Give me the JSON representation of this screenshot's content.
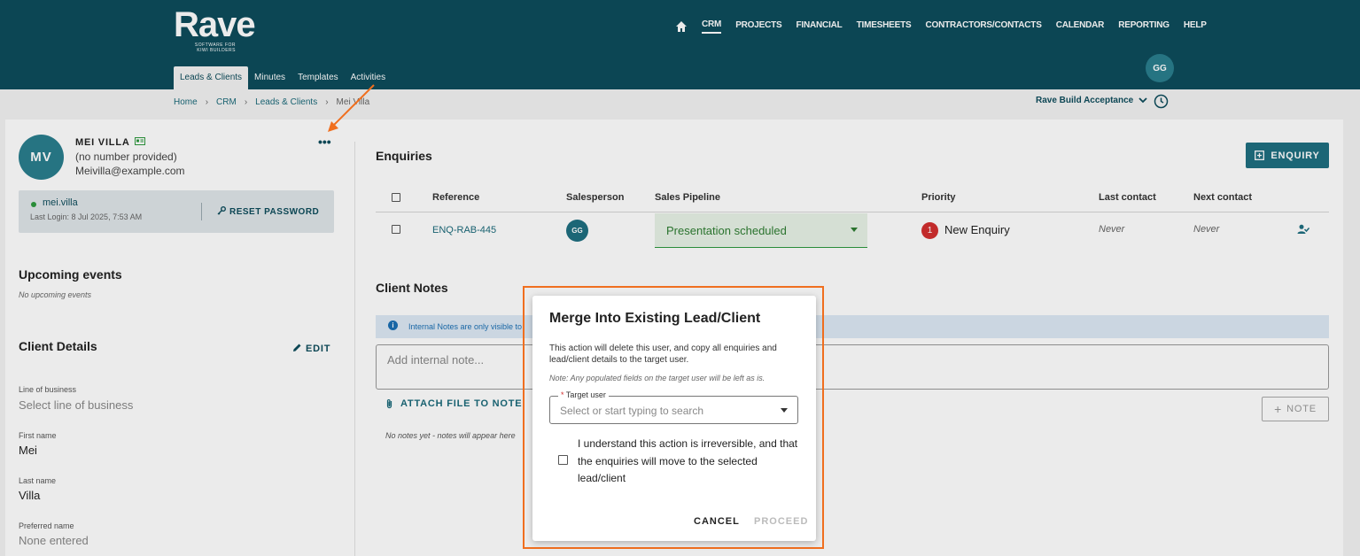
{
  "brand": {
    "logo_text": "Rave",
    "logo_sub_1": "SOFTWARE FOR",
    "logo_sub_2": "KIWI BUILDERS"
  },
  "top_nav": {
    "home_icon": "home-icon",
    "items": [
      "CRM",
      "PROJECTS",
      "FINANCIAL",
      "TIMESHEETS",
      "CONTRACTORS/CONTACTS",
      "CALENDAR",
      "REPORTING",
      "HELP"
    ],
    "active": "CRM"
  },
  "user_avatar": "GG",
  "sub_tabs": [
    "Leads & Clients",
    "Minutes",
    "Templates",
    "Activities"
  ],
  "breadcrumb": [
    "Home",
    "CRM",
    "Leads & Clients",
    "Mei Villa"
  ],
  "breadcrumb_sep": "›",
  "org_selector": "Rave Build Acceptance",
  "client": {
    "initials": "MV",
    "name": "MEI VILLA",
    "phone": "(no number provided)",
    "email": "Meivilla@example.com",
    "username": "mei.villa",
    "last_login": "Last Login: 8 Jul 2025, 7:53 AM",
    "reset_password": "RESET PASSWORD",
    "more_glyph": "•••"
  },
  "upcoming": {
    "title": "Upcoming events",
    "empty": "No upcoming events"
  },
  "client_details": {
    "title": "Client Details",
    "edit": "EDIT",
    "fields": [
      {
        "label": "Line of business",
        "value": "Select line of business"
      },
      {
        "label": "First name",
        "value": "Mei"
      },
      {
        "label": "Last name",
        "value": "Villa"
      },
      {
        "label": "Preferred name",
        "value": "None entered"
      }
    ]
  },
  "enquiries": {
    "title": "Enquiries",
    "add_button": "ENQUIRY",
    "headers": [
      "Reference",
      "Salesperson",
      "Sales Pipeline",
      "Priority",
      "Last contact",
      "Next contact"
    ],
    "rows": [
      {
        "reference": "ENQ-RAB-445",
        "salesperson": "GG",
        "pipeline": "Presentation scheduled",
        "priority_num": "1",
        "priority": "New Enquiry",
        "last_contact": "Never",
        "next_contact": "Never"
      }
    ]
  },
  "notes": {
    "title": "Client Notes",
    "info_icon": "i",
    "info": "Internal Notes are only visible to",
    "placeholder": "Add internal note...",
    "attach": "ATTACH FILE TO NOTE",
    "note_button": "NOTE",
    "empty": "No notes yet - notes will appear here"
  },
  "modal": {
    "title": "Merge Into Existing Lead/Client",
    "description": "This action will delete this user, and copy all enquiries and lead/client details to the target user.",
    "note": "Note: Any populated fields on the target user will be left as is.",
    "target_required": "*",
    "target_label": "Target user",
    "target_placeholder": "Select or start typing to search",
    "acknowledge": "I understand this action is irreversible, and that the enquiries will move to the selected lead/client",
    "cancel": "CANCEL",
    "proceed": "PROCEED"
  },
  "colors": {
    "brand_dark": "#0e4d5c",
    "accent": "#1f6f80",
    "highlight": "#f06f1f",
    "priority_badge": "#d32f2f",
    "pipeline_green": "#2e7d32"
  }
}
